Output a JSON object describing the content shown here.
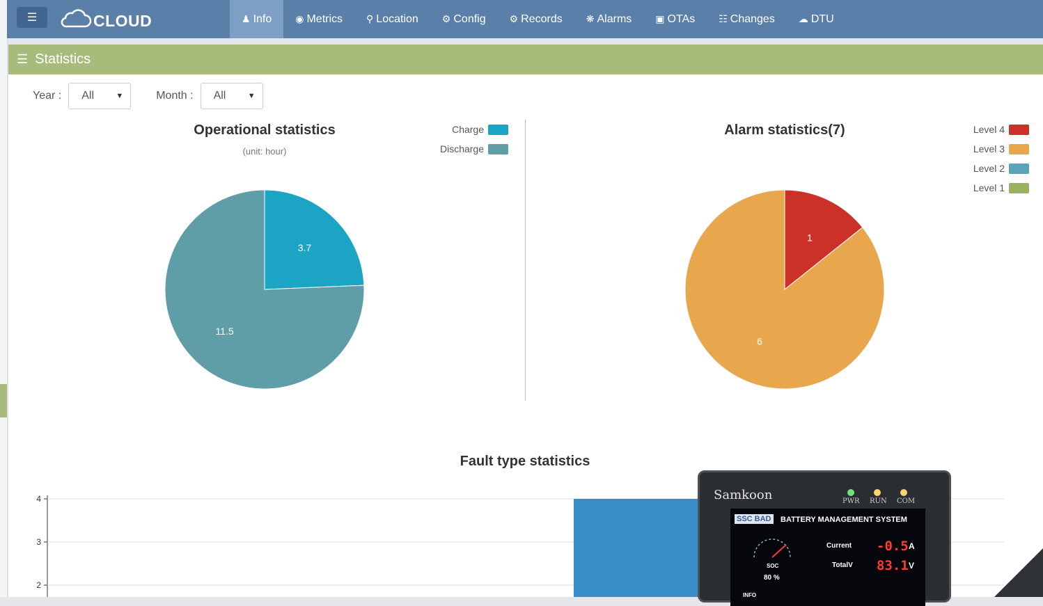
{
  "topbar": {
    "brand": "CLOUD",
    "nav": [
      {
        "label": "Info",
        "icon": "users-icon",
        "active": true
      },
      {
        "label": "Metrics",
        "icon": "eye-icon"
      },
      {
        "label": "Location",
        "icon": "map-marker-icon"
      },
      {
        "label": "Config",
        "icon": "gear-icon"
      },
      {
        "label": "Records",
        "icon": "gears-icon"
      },
      {
        "label": "Alarms",
        "icon": "bug-icon"
      },
      {
        "label": "OTAs",
        "icon": "medkit-icon"
      },
      {
        "label": "Changes",
        "icon": "sitemap-icon"
      },
      {
        "label": "DTU",
        "icon": "cloud-upload-icon"
      }
    ]
  },
  "panel": {
    "title": "Statistics",
    "filters": {
      "year_label": "Year :",
      "year_value": "All",
      "month_label": "Month :",
      "month_value": "All"
    }
  },
  "chart_data": [
    {
      "type": "pie",
      "title": "Operational statistics",
      "subtitle": "(unit: hour)",
      "labels": [
        "Charge",
        "Discharge"
      ],
      "values": [
        3.7,
        11.5
      ],
      "colors": [
        "#1ba4c4",
        "#5f9ea6"
      ],
      "legend": "top-right"
    },
    {
      "type": "pie",
      "title": "Alarm statistics(7)",
      "labels": [
        "Level 4",
        "Level 3",
        "Level 2",
        "Level 1"
      ],
      "values": [
        1,
        6,
        0,
        0
      ],
      "colors": [
        "#cb3029",
        "#e8a74c",
        "#5ba3b9",
        "#97b35f"
      ],
      "legend": "top-right"
    },
    {
      "type": "bar",
      "title": "Fault type statistics",
      "ytick_labels": [
        "4",
        "3",
        "2"
      ],
      "ylim": [
        1.7,
        4
      ],
      "values_visible": [
        4
      ],
      "grid": true,
      "color": "#3a8ec8"
    }
  ],
  "device": {
    "brand": "Samkoon",
    "leds": [
      "PWR",
      "RUN",
      "COM"
    ],
    "screen_title": "BATTERY MANAGEMENT SYSTEM",
    "screen_badge": "SSC BAD",
    "current_label": "Current",
    "current_value": "-0.5",
    "current_unit": "A",
    "total_label": "TotalV",
    "total_value": "83.1",
    "total_unit": "V",
    "soc_label": "SOC",
    "soc_value": "80 %",
    "info_label": "INFO"
  }
}
